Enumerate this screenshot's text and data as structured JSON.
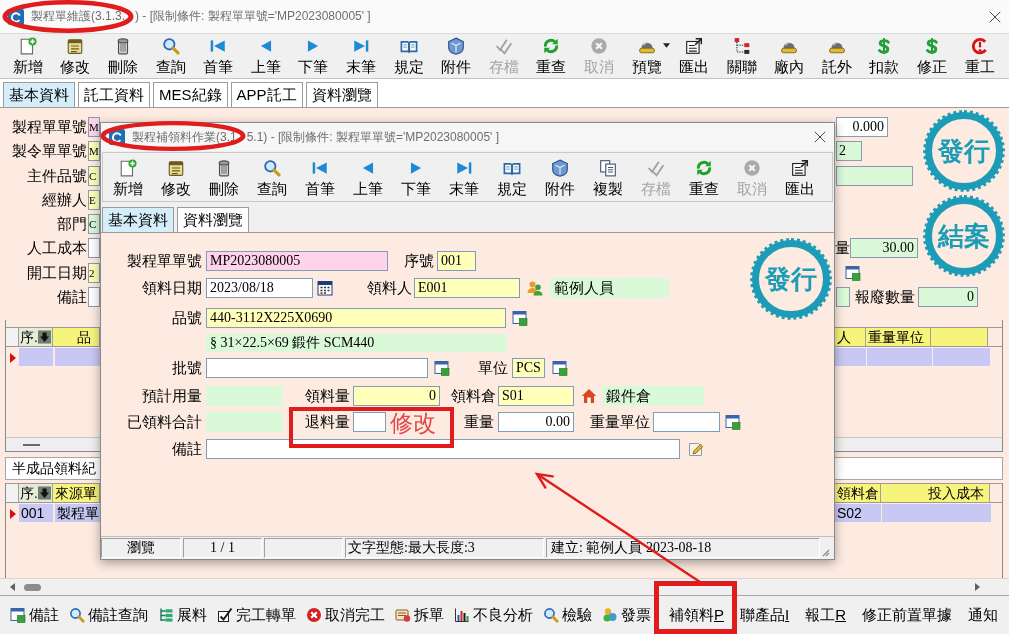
{
  "main_window": {
    "title_parts": [
      "製程單維護(3.1.3.",
      ") - [限制條件: 製程單單號='MP2023080005' ]"
    ],
    "toolbar": [
      {
        "label": "新增",
        "kind": "add",
        "disabled": false,
        "dropdown": false
      },
      {
        "label": "修改",
        "kind": "edit",
        "disabled": false,
        "dropdown": false
      },
      {
        "label": "刪除",
        "kind": "delete",
        "disabled": false,
        "dropdown": false
      },
      {
        "label": "查詢",
        "kind": "search",
        "disabled": false,
        "dropdown": false
      },
      {
        "label": "首筆",
        "kind": "first",
        "disabled": false,
        "dropdown": false
      },
      {
        "label": "上筆",
        "kind": "prev",
        "disabled": false,
        "dropdown": false
      },
      {
        "label": "下筆",
        "kind": "next",
        "disabled": false,
        "dropdown": false
      },
      {
        "label": "末筆",
        "kind": "last",
        "disabled": false,
        "dropdown": false
      },
      {
        "label": "規定",
        "kind": "rules",
        "disabled": false,
        "dropdown": false
      },
      {
        "label": "附件",
        "kind": "attach",
        "disabled": false,
        "dropdown": false
      },
      {
        "label": "存檔",
        "kind": "save",
        "disabled": true,
        "dropdown": false
      },
      {
        "label": "重查",
        "kind": "refresh",
        "disabled": false,
        "dropdown": false
      },
      {
        "label": "取消",
        "kind": "cancel",
        "disabled": true,
        "dropdown": false
      },
      {
        "label": "預覽",
        "kind": "preview",
        "disabled": false,
        "dropdown": true
      },
      {
        "label": "匯出",
        "kind": "export",
        "disabled": false,
        "dropdown": false
      },
      {
        "label": "關聯",
        "kind": "link",
        "disabled": false,
        "dropdown": false
      },
      {
        "label": "廠內",
        "kind": "factory",
        "disabled": false,
        "dropdown": false
      },
      {
        "label": "託外",
        "kind": "outsource",
        "disabled": false,
        "dropdown": false
      },
      {
        "label": "扣款",
        "kind": "deduct",
        "disabled": false,
        "dropdown": false
      },
      {
        "label": "修正",
        "kind": "correct",
        "disabled": false,
        "dropdown": false
      },
      {
        "label": "重工",
        "kind": "rework",
        "disabled": false,
        "dropdown": false
      }
    ],
    "tabs": [
      {
        "label": "基本資料",
        "selected": true
      },
      {
        "label": "託工資料",
        "selected": false
      },
      {
        "label": "MES紀錄",
        "selected": false
      },
      {
        "label": "APP託工",
        "selected": false
      },
      {
        "label": "資料瀏覽",
        "selected": false
      }
    ],
    "form": {
      "left_fields": [
        {
          "label": "製程單單號",
          "value": "M",
          "kind": "key"
        },
        {
          "label": "製令單單號",
          "value": "M",
          "kind": "required"
        },
        {
          "label": "主件品號",
          "value": "C",
          "kind": "required"
        },
        {
          "label": "經辦人",
          "value": "E",
          "kind": "required"
        },
        {
          "label": "部門",
          "value": "C",
          "kind": "display"
        },
        {
          "label": "人工成本",
          "kind": "input"
        },
        {
          "label": "開工日期",
          "value": "2",
          "kind": "required"
        },
        {
          "label": "備註",
          "kind": "input"
        }
      ],
      "right_fields": [
        {
          "value": "0.000",
          "kind": "input"
        },
        {
          "value": "2",
          "kind": "display"
        },
        {
          "kind": "display"
        }
      ],
      "amount": {
        "label": "量",
        "value": "30.00",
        "kind": "display"
      },
      "partial_field": {
        "kind": "display"
      },
      "scrap_qty": {
        "label": "報廢數量",
        "value": "0",
        "kind": "display"
      }
    },
    "stamps": [
      "發行",
      "結案"
    ],
    "grid_1": {
      "left_columns": [
        "序.",
        "品"
      ],
      "right_columns": [
        "人",
        "重量單位"
      ],
      "rows": [
        {
          "current": true
        }
      ]
    },
    "section_caption": "半成品領料紀",
    "grid_2": {
      "left_columns": [
        "序.",
        "來源單"
      ],
      "right_columns": [
        "領料倉",
        "投入成本"
      ],
      "rows": [
        {
          "current": true,
          "left_cells": [
            "001",
            "製程單"
          ],
          "right_cells": [
            "S02"
          ]
        }
      ]
    },
    "action_bar": [
      {
        "label": "備註",
        "kind": "note"
      },
      {
        "label": "備註查詢",
        "kind": "note-search"
      },
      {
        "label": "展料",
        "kind": "tree"
      },
      {
        "label": "完工轉單",
        "kind": "complete"
      },
      {
        "label": "取消完工",
        "kind": "cancel-red"
      },
      {
        "label": "拆單",
        "kind": "split"
      },
      {
        "label": "不良分析",
        "kind": "chart"
      },
      {
        "label": "檢驗",
        "kind": "inspect"
      },
      {
        "label": "發票",
        "kind": "invoice"
      },
      {
        "label": "補領料",
        "accelerator": "P",
        "kind": "text"
      },
      {
        "label": "聯產品",
        "accelerator": "I",
        "kind": "text"
      },
      {
        "label": "報工",
        "accelerator": "R",
        "kind": "text"
      },
      {
        "label": "修正前置單據",
        "kind": "text"
      },
      {
        "label": "通知",
        "kind": "text"
      }
    ]
  },
  "dialog": {
    "title_parts": [
      "製程補領料作業(3.1",
      "5.1) - [限制條件: 製程單單號='MP2023080005' ]"
    ],
    "toolbar": [
      {
        "label": "新增",
        "kind": "add",
        "disabled": false
      },
      {
        "label": "修改",
        "kind": "edit",
        "disabled": false
      },
      {
        "label": "刪除",
        "kind": "delete",
        "disabled": false
      },
      {
        "label": "查詢",
        "kind": "search",
        "disabled": false
      },
      {
        "label": "首筆",
        "kind": "first",
        "disabled": false
      },
      {
        "label": "上筆",
        "kind": "prev",
        "disabled": false
      },
      {
        "label": "下筆",
        "kind": "next",
        "disabled": false
      },
      {
        "label": "末筆",
        "kind": "last",
        "disabled": false
      },
      {
        "label": "規定",
        "kind": "rules",
        "disabled": false
      },
      {
        "label": "附件",
        "kind": "attach",
        "disabled": false
      },
      {
        "label": "複製",
        "kind": "copy",
        "disabled": false
      },
      {
        "label": "存檔",
        "kind": "save",
        "disabled": true
      },
      {
        "label": "重查",
        "kind": "refresh",
        "disabled": false
      },
      {
        "label": "取消",
        "kind": "cancel",
        "disabled": true
      },
      {
        "label": "匯出",
        "kind": "export",
        "disabled": false
      }
    ],
    "tabs": [
      {
        "label": "基本資料",
        "selected": true
      },
      {
        "label": "資料瀏覽",
        "selected": false
      }
    ],
    "stamp": "發行",
    "form": {
      "order_no": {
        "label": "製程單單號",
        "value": "MP2023080005",
        "kind": "key"
      },
      "seq_no": {
        "label": "序號",
        "value": "001",
        "kind": "required"
      },
      "issue_date": {
        "label": "領料日期",
        "value": "2023/08/18",
        "kind": "input"
      },
      "picker": {
        "label": "領料人",
        "value": "E001",
        "kind": "required",
        "name": "範例人員"
      },
      "item_no": {
        "label": "品號",
        "value": "440-3112X225X0690",
        "kind": "required",
        "description": "§ 31×22.5×69 鍛件 SCM440"
      },
      "lot_no": {
        "label": "批號",
        "kind": "input"
      },
      "unit": {
        "label": "單位",
        "value": "PCS",
        "kind": "required"
      },
      "planned_qty": {
        "label": "預計用量",
        "kind": "display"
      },
      "issue_qty": {
        "label": "領料量",
        "value": "0",
        "kind": "required"
      },
      "warehouse": {
        "label": "領料倉",
        "value": "S01",
        "kind": "required",
        "name": "鍛件倉"
      },
      "issued_total": {
        "label": "已領料合計",
        "kind": "display"
      },
      "return_qty": {
        "label": "退料量",
        "kind": "input"
      },
      "weight": {
        "label": "重量",
        "value": "0.00",
        "kind": "input"
      },
      "weight_unit": {
        "label": "重量單位",
        "kind": "input"
      },
      "remark": {
        "label": "備註",
        "kind": "input"
      }
    },
    "status_bar": {
      "mode": "瀏覽",
      "record": "1 / 1",
      "field_info": "文字型態:最大長度:3",
      "created": "建立: 範例人員 2023-08-18"
    }
  },
  "annotations": {
    "note": "修改"
  }
}
